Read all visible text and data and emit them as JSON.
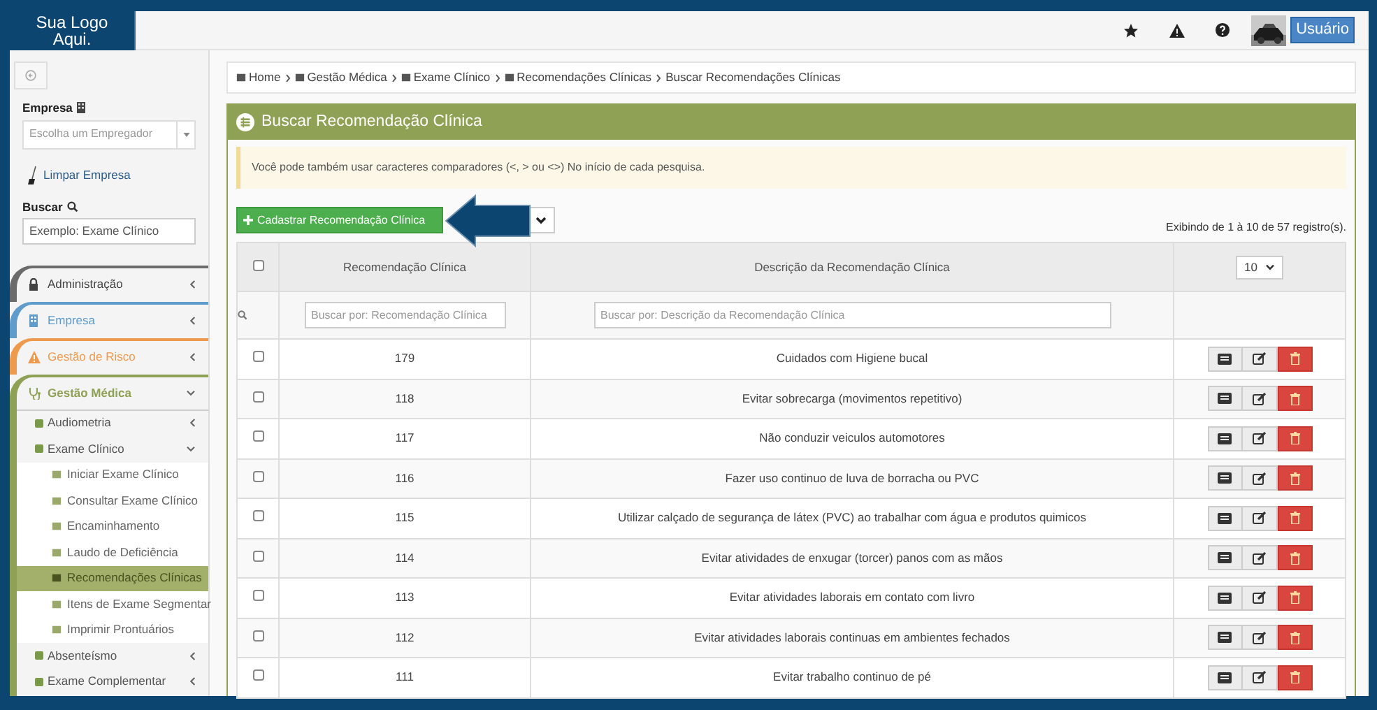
{
  "logo": {
    "text": "Sua Logo Aqui."
  },
  "top_bar": {
    "user_button": "Usuário"
  },
  "sidebar": {
    "company_label": "Empresa",
    "company_select": {
      "placeholder": "Escolha um Empregador"
    },
    "clear_link": "Limpar Empresa",
    "search_label": "Buscar",
    "search_field": {
      "placeholder": "Exemplo: Exame Clínico"
    },
    "menu": [
      {
        "label": "Administração",
        "color": "#6b6b6b",
        "expanded": false
      },
      {
        "label": "Empresa",
        "color": "#5f9ccc",
        "expanded": false
      },
      {
        "label": "Gestão de Risco",
        "color": "#ee9a4d",
        "expanded": false
      },
      {
        "label": "Gestão Médica",
        "color": "#8ea154",
        "expanded": true,
        "children": [
          {
            "label": "Audiometria",
            "expanded": false
          },
          {
            "label": "Exame Clínico",
            "expanded": true,
            "children": [
              {
                "label": "Iniciar Exame Clínico",
                "selected": false
              },
              {
                "label": "Consultar Exame Clínico",
                "selected": false
              },
              {
                "label": "Encaminhamento",
                "selected": false
              },
              {
                "label": "Laudo de Deficiência",
                "selected": false
              },
              {
                "label": "Recomendações Clínicas",
                "selected": true
              },
              {
                "label": "Itens de Exame Segmentar",
                "selected": false
              },
              {
                "label": "Imprimir Prontuários",
                "selected": false
              }
            ]
          },
          {
            "label": "Absenteísmo",
            "expanded": false
          },
          {
            "label": "Exame Complementar",
            "expanded": false
          }
        ]
      }
    ]
  },
  "breadcrumb": [
    {
      "label": "Home"
    },
    {
      "label": "Gestão Médica"
    },
    {
      "label": "Exame Clínico"
    },
    {
      "label": "Recomendações Clínicas"
    },
    {
      "label": "Buscar Recomendações Clínicas"
    }
  ],
  "panel": {
    "title": "Buscar Recomendação Clínica",
    "alert": "Você pode também usar caracteres comparadores (<, > ou <>) No início de cada pesquisa.",
    "add_button": "Cadastrar Recomendação Clínica",
    "records": "Exibindo de 1 à 10 de 57 registro(s).",
    "table": {
      "columns": [
        "Recomendação Clínica",
        "Descrição da Recomendação Clínica"
      ],
      "page_size": "10",
      "filters": [
        {
          "placeholder": "Buscar por: Recomendação Clínica"
        },
        {
          "placeholder": "Buscar por: Descrição da Recomendação Clínica"
        }
      ],
      "all_checked": false,
      "rows": [
        {
          "id": "179",
          "description": "Cuidados com Higiene bucal",
          "checked": false
        },
        {
          "id": "118",
          "description": "Evitar sobrecarga (movimentos repetitivo)",
          "checked": false
        },
        {
          "id": "117",
          "description": "Não conduzir veiculos automotores",
          "checked": false
        },
        {
          "id": "116",
          "description": "Fazer uso continuo de luva de borracha ou PVC",
          "checked": false
        },
        {
          "id": "115",
          "description": "Utilizar calçado de segurança de látex (PVC) ao trabalhar com água e produtos quimicos",
          "checked": false
        },
        {
          "id": "114",
          "description": "Evitar atividades de enxugar (torcer) panos com as mãos",
          "checked": false
        },
        {
          "id": "113",
          "description": "Evitar atividades laborais em contato com livro",
          "checked": false
        },
        {
          "id": "112",
          "description": "Evitar atividades laborais continuas em ambientes fechados",
          "checked": false
        },
        {
          "id": "111",
          "description": "Evitar trabalho continuo de pé",
          "checked": false
        }
      ]
    }
  }
}
